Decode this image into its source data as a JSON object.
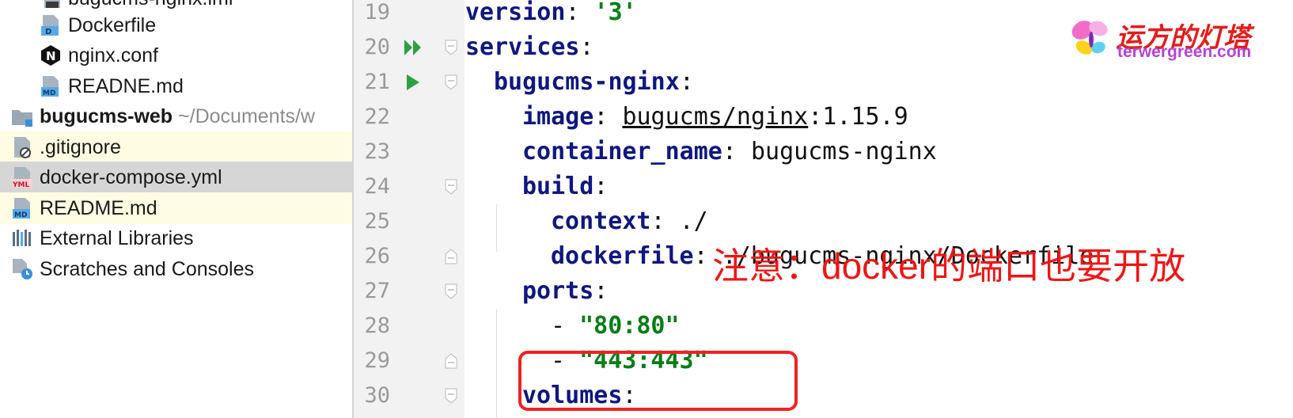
{
  "project_tree": {
    "items": [
      {
        "name": "bugucms-nginx.iml"
      },
      {
        "name": "Dockerfile",
        "icon_badge": "D"
      },
      {
        "name": "nginx.conf",
        "icon_badge": "N"
      },
      {
        "name": "READNE.md",
        "icon_badge": "MD"
      },
      {
        "name": "bugucms-web",
        "path": "~/Documents/w"
      },
      {
        "name": ".gitignore"
      },
      {
        "name": "docker-compose.yml",
        "icon_badge": "YML"
      },
      {
        "name": "README.md",
        "icon_badge": "MD"
      },
      {
        "name": "External Libraries"
      },
      {
        "name": "Scratches and Consoles"
      }
    ]
  },
  "editor": {
    "line_numbers": [
      "19",
      "20",
      "21",
      "22",
      "23",
      "24",
      "25",
      "26",
      "27",
      "28",
      "29",
      "30"
    ],
    "lines": {
      "l19": {
        "key": "version",
        "sep": ": ",
        "value": "'3'"
      },
      "l20": {
        "key": "services",
        "sep": ":"
      },
      "l21": {
        "key": "bugucms-nginx",
        "sep": ":"
      },
      "l22": {
        "key": "image",
        "sep": ": ",
        "value_link": "bugucms/nginx",
        "value_rest": ":1.15.9"
      },
      "l23": {
        "key": "container_name",
        "sep": ": ",
        "value": "bugucms-nginx"
      },
      "l24": {
        "key": "build",
        "sep": ":"
      },
      "l25": {
        "key": "context",
        "sep": ": ",
        "value": "./"
      },
      "l26": {
        "key": "dockerfile",
        "sep": ": ",
        "value": "./bugucms-nginx/Dockerfile"
      },
      "l27": {
        "key": "ports",
        "sep": ":"
      },
      "l28": {
        "dash": "- ",
        "value": "\"80:80\""
      },
      "l29": {
        "dash": "- ",
        "value": "\"443:443\""
      },
      "l30": {
        "key": "volumes",
        "sep": ":"
      }
    }
  },
  "annotation": {
    "text": "注意：docker的端口也要开放"
  },
  "watermark": {
    "title": "运方的灯塔",
    "site": "terwergreen.com"
  },
  "colors": {
    "key": "#0f1780",
    "string": "#067d17",
    "annotation": "#f01515",
    "run_icon": "#2ea043",
    "selected_row": "#d6d6d6",
    "vcs_unversioned": "#fefde3"
  }
}
